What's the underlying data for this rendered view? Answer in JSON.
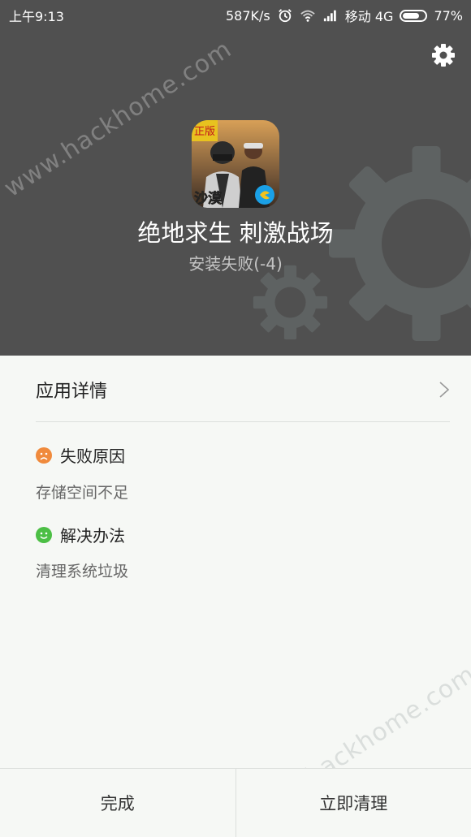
{
  "status_bar": {
    "time": "上午9:13",
    "speed": "587K/s",
    "carrier": "移动 4G",
    "battery": "77%",
    "battery_level": 0.77,
    "icons": [
      "alarm-icon",
      "wifi-icon",
      "signal-icon",
      "battery-icon"
    ]
  },
  "header": {
    "watermark": "www.hackhome.com",
    "app_icon": {
      "badge_top": "正版",
      "badge_bottom": "沙漠"
    },
    "app_name": "绝地求生 刺激战场",
    "install_status": "安装失败(-4)"
  },
  "details": {
    "label": "应用详情"
  },
  "failure": {
    "title": "失败原因",
    "text": "存储空间不足",
    "color": "#f08a3c"
  },
  "solution": {
    "title": "解决办法",
    "text": "清理系统垃圾",
    "color": "#4cbf45"
  },
  "bottom": {
    "done_label": "完成",
    "clean_label": "立即清理"
  },
  "colors": {
    "header_bg": "#505050",
    "page_bg": "#f6f8f5"
  }
}
